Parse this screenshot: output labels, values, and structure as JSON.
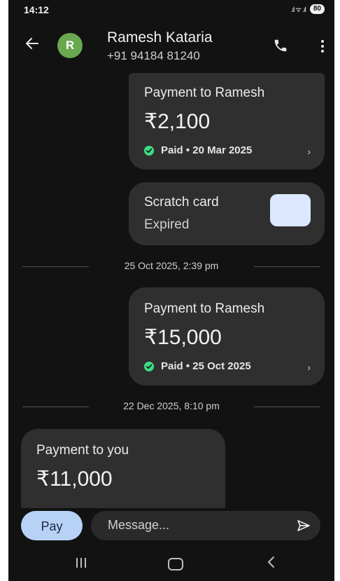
{
  "status_bar": {
    "time": "14:12",
    "signal": ".ıl ᯤ .ıl",
    "battery": "80"
  },
  "header": {
    "avatar_letter": "R",
    "contact_name": "Ramesh Kataria",
    "contact_phone": "+91 94184 81240",
    "avatar_color": "#6aa84f"
  },
  "messages": {
    "payment1": {
      "title": "Payment to Ramesh",
      "amount": "₹2,100",
      "status": "Paid • 20 Mar 2025"
    },
    "scratch": {
      "title": "Scratch card",
      "status": "Expired"
    },
    "date1": "25 Oct 2025, 2:39 pm",
    "payment2": {
      "title": "Payment to Ramesh",
      "amount": "₹15,000",
      "status": "Paid • 25 Oct 2025"
    },
    "date2": "22 Dec 2025, 8:10 pm",
    "payment3": {
      "title": "Payment to you",
      "amount": "₹11,000"
    }
  },
  "composer": {
    "pay_label": "Pay",
    "placeholder": "Message..."
  },
  "icons": {
    "back": "arrow-left-icon",
    "call": "phone-icon",
    "more": "more-vertical-icon",
    "paid": "check-circle-icon",
    "chevron": "chevron-right-icon",
    "send": "send-icon"
  },
  "colors": {
    "accent_pay": "#b8d2f6",
    "paid_green": "#3ddc84",
    "bubble": "#2f2f2f"
  }
}
